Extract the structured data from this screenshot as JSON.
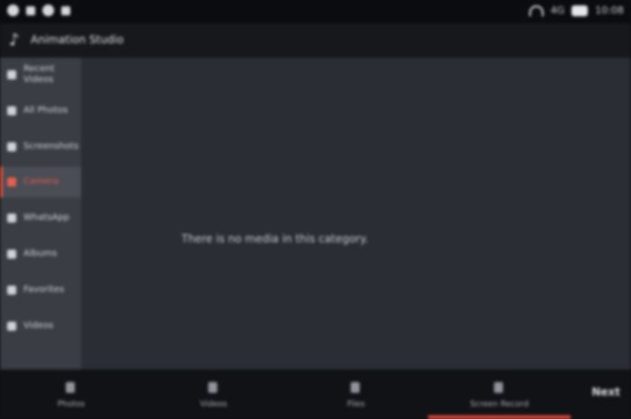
{
  "status_bar": {
    "time": "10:08",
    "network": "4G"
  },
  "header": {
    "title": "Animation Studio"
  },
  "sidebar": {
    "items": [
      {
        "label": "Recent Videos",
        "icon": "clock-icon",
        "active": false
      },
      {
        "label": "All Photos",
        "icon": "image-icon",
        "active": false
      },
      {
        "label": "Screenshots",
        "icon": "screenshot-icon",
        "active": false
      },
      {
        "label": "Camera",
        "icon": "camera-icon",
        "active": true
      },
      {
        "label": "WhatsApp",
        "icon": "chat-icon",
        "active": false
      },
      {
        "label": "Albums",
        "icon": "album-icon",
        "active": false
      },
      {
        "label": "Favorites",
        "icon": "star-icon",
        "active": false
      },
      {
        "label": "Videos",
        "icon": "video-icon",
        "active": false
      }
    ]
  },
  "main": {
    "empty_message": "There is no media in this category."
  },
  "bottom_nav": {
    "tabs": [
      {
        "label": "Photos",
        "icon": "photo-icon",
        "active": false
      },
      {
        "label": "Videos",
        "icon": "video-icon",
        "active": false
      },
      {
        "label": "Files",
        "icon": "file-icon",
        "active": false
      },
      {
        "label": "Screen Record",
        "icon": "record-icon",
        "active": true
      }
    ],
    "next_label": "Next"
  },
  "colors": {
    "accent": "#e44b3c",
    "sidebar_bg": "#3a3d44",
    "main_bg": "#2a2d34"
  }
}
